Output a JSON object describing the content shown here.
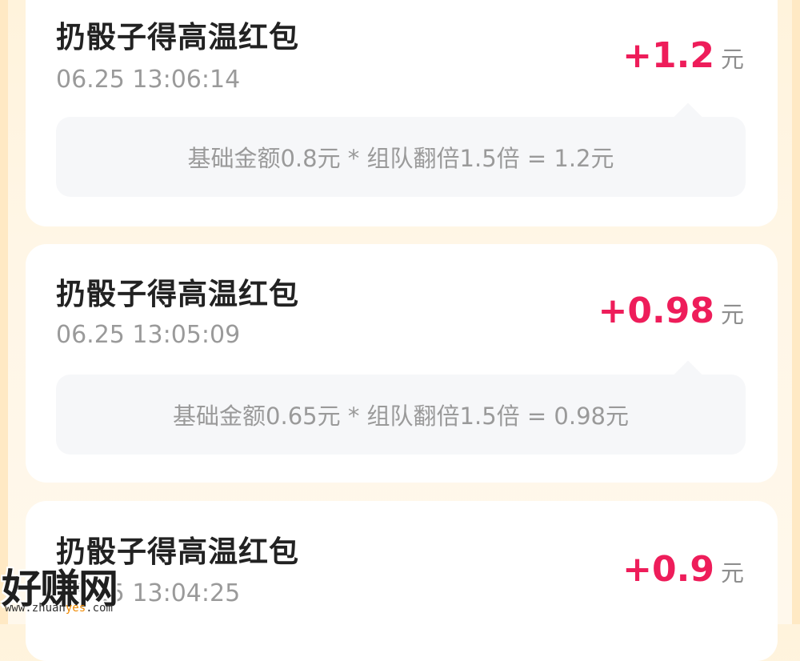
{
  "records": [
    {
      "title": "扔骰子得高温红包",
      "time": "06.25 13:06:14",
      "amount": "+1.2",
      "unit": "元",
      "formula": "基础金额0.8元 * 组队翻倍1.5倍 = 1.2元"
    },
    {
      "title": "扔骰子得高温红包",
      "time": "06.25 13:05:09",
      "amount": "+0.98",
      "unit": "元",
      "formula": "基础金额0.65元 * 组队翻倍1.5倍 = 0.98元"
    },
    {
      "title": "扔骰子得高温红包",
      "time": "06.25 13:04:25",
      "amount": "+0.9",
      "unit": "元"
    }
  ],
  "watermark": {
    "main": "好赚网",
    "url_prefix": "www.zhuan",
    "url_highlight": "yes",
    "url_suffix": ".com"
  },
  "colors": {
    "amount": "#ee1d5a",
    "background": "#fff3dc",
    "card": "#ffffff",
    "formula_box": "#f6f7f9"
  }
}
